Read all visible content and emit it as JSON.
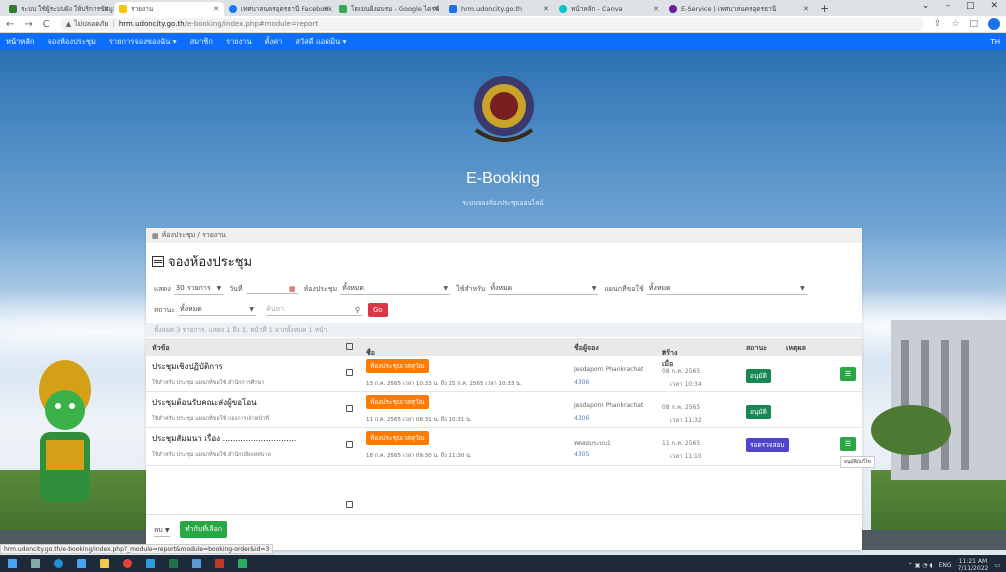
{
  "browser": {
    "tabs": [
      {
        "title": "ระบบ ใช้ผู้ระบบฝัง ให้บริการข้อมูล",
        "color": "#2e7d32",
        "active": false
      },
      {
        "title": "รายงาน",
        "color": "#f9c400",
        "active": true
      },
      {
        "title": "เทศบาลนครอุดรธานี Facebook",
        "color": "#1877f2",
        "active": false
      },
      {
        "title": "โดเมนฝั่งอบรม - Google ไดรฟ์",
        "color": "#34a853",
        "active": false
      },
      {
        "title": "hrm.udoncity.go.th",
        "color": "#1a73e8",
        "active": false
      },
      {
        "title": "หน้าหลัก - Canva",
        "color": "#00c4cc",
        "active": false
      },
      {
        "title": "E-Service | เทศบาลนครอุดรธานี",
        "color": "#6a1b9a",
        "active": false
      }
    ],
    "new_tab": "+",
    "window_controls": [
      "⌄",
      "–",
      "□",
      "✕"
    ],
    "nav": [
      "←",
      "→",
      "C"
    ],
    "security_label": "ไม่ปลอดภัย",
    "url_host": "hrm.udoncity.go.th",
    "url_path": "/e-booking/index.php#module=report",
    "right_icons": [
      "⇪",
      "☆",
      "□"
    ]
  },
  "navbar": {
    "items": [
      "หน้าหลัก",
      "จองห้องประชุม",
      "รายการจองของฉัน ▾",
      "สมาชิก",
      "รายงาน",
      "ตั้งค่า",
      "สวัสดี แอดมิน ▾"
    ],
    "user_initials": "TH"
  },
  "hero": {
    "brand": "E-Booking",
    "subtitle": "ระบบจองห้องประชุมออนไลน์"
  },
  "page": {
    "breadcrumb": "ห้องประชุม / รายงาน",
    "title": "จองห้องประชุม",
    "filters": {
      "show_label": "แสดง",
      "show_value": "30 รายการ",
      "date_label": "วันที่",
      "room_label": "ห้องประชุม",
      "room_value": "ทั้งหมด",
      "use_label": "ใช้สำหรับ",
      "use_value": "ทั้งหมด",
      "dept_label": "แผนกที่ขอใช้",
      "dept_value": "ทั้งหมด",
      "status_label": "สถานะ",
      "status_value": "ทั้งหมด",
      "search_placeholder": "ค้นหา",
      "go_label": "Go"
    },
    "summary": "ทั้งหมด 3 รายการ, แสดง 1 ถึง 3, หน้าที่ 1 จากทั้งหมด 1 หน้า",
    "columns": [
      "หัวข้อ",
      "ชื่อห้อง",
      "ชื่อผู้จอง",
      "สร้างเมื่อ",
      "สถานะ",
      "เหตุผล"
    ],
    "sort_room": "⇕",
    "sort_date": "▾",
    "rows": [
      {
        "subject": "ประชุมเชิงปฏิบัติการ",
        "note": "ใช้สำหรับ ประชุม แผนกที่ขอใช้ สำนักการศึกษา",
        "room": "ห้องประชุมเวสสุวัณ",
        "time": "13 ก.ค. 2565 เวลา 10:33 น. ถึง 15 ก.ค. 2565 เวลา 10:33 น.",
        "user": "Jesdaporn Phankrachat",
        "uid": "4306",
        "date": "08 ก.ค. 2565",
        "dtime": "เวลา 10:34",
        "status": "อนุมัติ",
        "status_color": "#198754"
      },
      {
        "subject": "ประชุมต้อนรับคณะส่งผู้ขอโอน",
        "note": "ใช้สำหรับ ประชุม แผนกที่ขอใช้ กองการเจ้าหน้าที่",
        "room": "ห้องประชุมเวสสุวัณ",
        "time": "11 ก.ค. 2565 เวลา 08:31 น. ถึง 10:31 น.",
        "user": "Jesdaporn Phankrachat",
        "uid": "4306",
        "date": "08 ก.ค. 2565",
        "dtime": "เวลา 11:32",
        "status": "อนุมัติ",
        "status_color": "#198754"
      },
      {
        "subject": "ประชุมสัมมนา เรื่อง .............................",
        "note": "ใช้สำหรับ ประชุม แผนกที่ขอใช้ สำนักปลัดเทศบาล",
        "room": "ห้องประชุมเวสสุวัณ",
        "time": "18 ก.ค. 2565 เวลา 09:30 น. ถึง 11:30 น.",
        "user": "ทดสอบระบบ1",
        "uid": "4305",
        "date": "11 ก.ค. 2565",
        "dtime": "เวลา 11:10",
        "status": "รอตรวจสอบ",
        "status_color": "#5145cd"
      }
    ],
    "action_tooltip": "อนุมัติ/แก้ไข",
    "bulk_select": "ลบ",
    "bulk_button": "ทำกับที่เลือก"
  },
  "statusbar": {
    "link": "hrm.udoncity.go.th/e-booking/index.php?_module=report&module=booking-order&id=3"
  },
  "taskbar": {
    "lang": "ENG",
    "time": "11:21 AM",
    "date": "7/11/2022"
  }
}
